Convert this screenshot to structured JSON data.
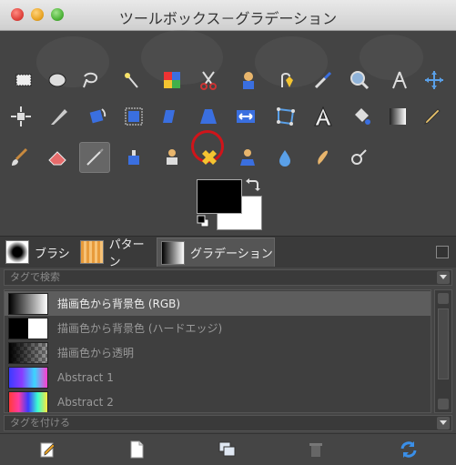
{
  "window": {
    "title": "ツールボックス－グラデーション"
  },
  "toolbox": {
    "highlighted_tool": "perspective-tool",
    "highlight_color": "#d0141a"
  },
  "colors": {
    "foreground": "#000000",
    "background": "#ffffff"
  },
  "dock": {
    "tabs": [
      {
        "label": "ブラシ"
      },
      {
        "label": "パターン"
      },
      {
        "label": "グラデーション"
      }
    ],
    "filter_placeholder": "タグで検索",
    "tag_placeholder": "タグを付ける",
    "gradients": [
      {
        "label": "描画色から背景色 (RGB)",
        "selected": true
      },
      {
        "label": "描画色から背景色 (ハードエッジ)",
        "selected": false
      },
      {
        "label": "描画色から透明",
        "selected": false
      },
      {
        "label": "Abstract 1",
        "selected": false
      },
      {
        "label": "Abstract 2",
        "selected": false
      }
    ]
  }
}
